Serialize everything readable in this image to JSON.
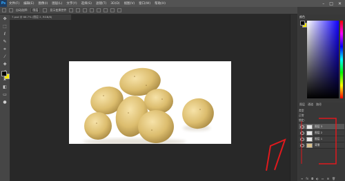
{
  "app": {
    "logo": "Ps"
  },
  "menu": {
    "items": [
      "文件(F)",
      "编辑(E)",
      "图像(I)",
      "图层(L)",
      "文字(Y)",
      "选择(S)",
      "滤镜(T)",
      "3D(D)",
      "视图(V)",
      "窗口(W)",
      "帮助(H)"
    ]
  },
  "window_controls": {
    "minimize": "–",
    "maximize": "□",
    "close": "✕"
  },
  "options_bar": {
    "sample_label": "自动选择:",
    "sample_value": "图层",
    "transform_label": "显示变换控件"
  },
  "document": {
    "tab_title": "7.psd @ 66.7% (图层 2, RGB/8)"
  },
  "colors": {
    "foreground": "#000000",
    "background": "#f3e600",
    "annotation": "#e0191d"
  },
  "color_panel": {
    "tab": "颜色"
  },
  "layers_panel": {
    "tabs": [
      "图层",
      "通道",
      "路径"
    ],
    "kind_label": "类型",
    "blend_label": "正常",
    "lock_label": "锁定:",
    "layers": [
      {
        "name": "图层 3",
        "thumb": "plain"
      },
      {
        "name": "图层 2",
        "thumb": "plain"
      },
      {
        "name": "图层 1",
        "thumb": "plain"
      },
      {
        "name": "背景",
        "thumb": "potato"
      }
    ]
  },
  "tools": [
    "move-icon",
    "marquee-icon",
    "lasso-icon",
    "quick-select-icon",
    "crop-icon",
    "eyedropper-icon",
    "healing-icon",
    "brush-icon",
    "stamp-icon",
    "history-brush-icon",
    "eraser-icon",
    "gradient-icon",
    "blur-icon",
    "dodge-icon",
    "pen-icon",
    "type-icon",
    "path-select-icon",
    "shape-icon",
    "hand-icon",
    "zoom-icon"
  ]
}
